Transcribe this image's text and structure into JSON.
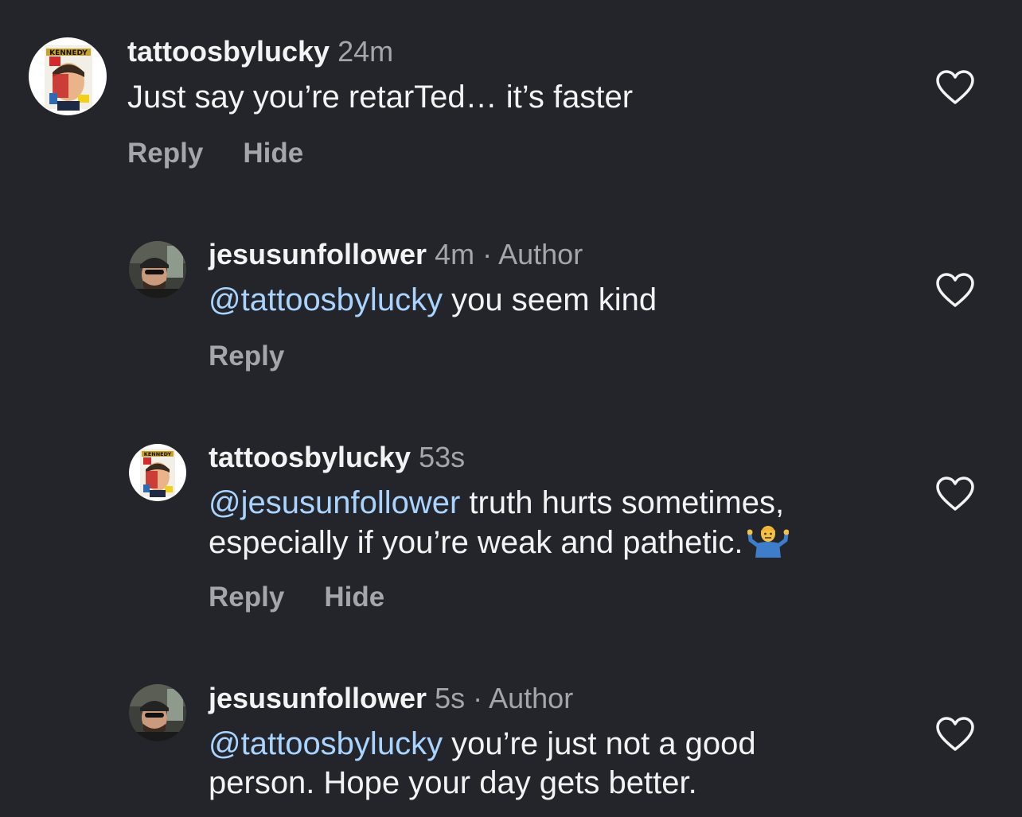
{
  "comments": [
    {
      "username": "tattoosbylucky",
      "time": "24m",
      "author_tag": "",
      "mention": "",
      "text": "Just say you’re retarTed… it’s faster",
      "reply_label": "Reply",
      "hide_label": "Hide"
    },
    {
      "username": "jesusunfollower",
      "time": "4m",
      "separator": "·",
      "author_tag": "Author",
      "mention": "@tattoosbylucky",
      "text": " you seem kind",
      "reply_label": "Reply"
    },
    {
      "username": "tattoosbylucky",
      "time": "53s",
      "author_tag": "",
      "mention": "@jesusunfollower",
      "text": " truth hurts sometimes,\nespecially if you’re weak and pathetic.",
      "emoji": "person-shrugging-emoji",
      "reply_label": "Reply",
      "hide_label": "Hide"
    },
    {
      "username": "jesusunfollower",
      "time": "5s",
      "separator": "·",
      "author_tag": "Author",
      "mention": "@tattoosbylucky",
      "text": " you’re just not a good\nperson. Hope your day gets better."
    }
  ],
  "icons": {
    "like": "heart-outline-icon"
  },
  "colors": {
    "background": "#24252a",
    "text": "#f3f3f5",
    "muted": "#a4a6ac",
    "mention": "#a8d4ff"
  }
}
